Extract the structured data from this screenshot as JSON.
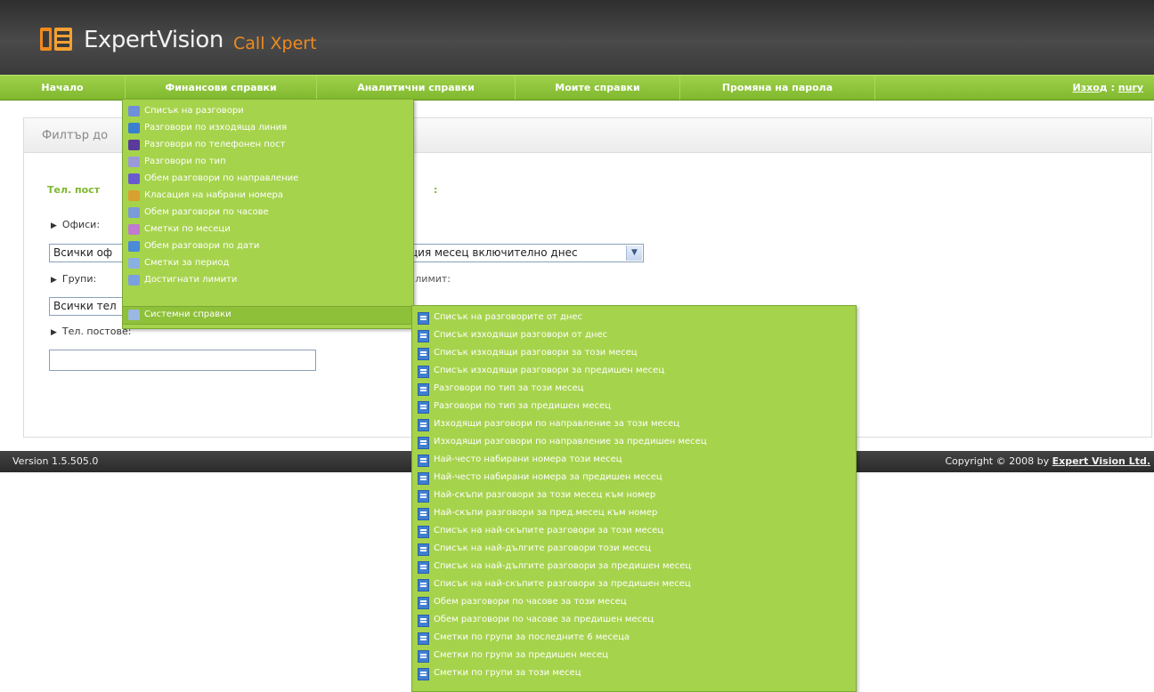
{
  "header": {
    "brand_name": "ExpertVision",
    "brand_product": "Call Xpert"
  },
  "nav": {
    "items": [
      "Начало",
      "Финансови справки",
      "Аналитични справки",
      "Моите справки",
      "Промяна на парола"
    ],
    "logout_label": "Изход",
    "username": "nury"
  },
  "filter": {
    "title": "Филтър до",
    "phone_line_title": "Тел. пост",
    "phone_line_suffix": ":",
    "offices_label": "Офиси:",
    "offices_value": "Всички оф",
    "period_value": "ция месец включително днес",
    "groups_label": "Групи:",
    "limit_label": "г лимит:",
    "groups_value": "Всички тел",
    "phone_posts_label": "Тел. постове:",
    "phone_posts_value": ""
  },
  "footer": {
    "version": "Version 1.5.505.0",
    "copyright_prefix": "Copyright © 2008 by ",
    "copyright_link": "Expert Vision Ltd."
  },
  "financial_menu": {
    "items": [
      {
        "label": "Списък на разговори",
        "icon": "list-icon",
        "color": "#6f8fd8"
      },
      {
        "label": "Разговори по изходяща линия",
        "icon": "bar-chart-icon",
        "color": "#3a7fd0"
      },
      {
        "label": "Разговори по телефонен пост",
        "icon": "area-chart-icon",
        "color": "#5a3a9a"
      },
      {
        "label": "Разговори по тип",
        "icon": "pie-chart-icon",
        "color": "#9a9ad8"
      },
      {
        "label": "Обем разговори по направление",
        "icon": "bar-chart-icon",
        "color": "#6a5ad0"
      },
      {
        "label": "Класация на набрани номера",
        "icon": "ranking-icon",
        "color": "#d8a030"
      },
      {
        "label": "Обем разговори по часове",
        "icon": "clock-chart-icon",
        "color": "#7a9ad8"
      },
      {
        "label": "Сметки по месеци",
        "icon": "line-chart-icon",
        "color": "#c07ad0"
      },
      {
        "label": "Обем разговори по дати",
        "icon": "calendar-chart-icon",
        "color": "#4a8ad8"
      },
      {
        "label": "Сметки за период",
        "icon": "period-icon",
        "color": "#8ab0e0"
      },
      {
        "label": "Достигнати лимити",
        "icon": "limit-icon",
        "color": "#7aa0e0"
      },
      {
        "label": "Системни справки",
        "icon": "system-icon",
        "color": "#9ab8e0"
      }
    ]
  },
  "system_menu": {
    "items": [
      "Списък на разговорите от днес",
      "Списък изходящи разговори от днес",
      "Списък изходящи разговори за този месец",
      "Списък изходящи разговори за предишен месец",
      "Разговори по тип за този месец",
      "Разговори по тип за предишен месец",
      "Изходящи разговори по направление за този месец",
      "Изходящи разговори по направление за предишен месец",
      "Най-често набирани номера този месец",
      "Най-често набирани номера за предишен месец",
      "Най-скъпи разговори за този месец към номер",
      "Най-скъпи разговори за пред.месец към номер",
      "Списък на най-скъпите разговори за този месец",
      "Списък на най-дългите разговори този месец",
      "Списък на най-дългите разговори за предишен месец",
      "Списък на най-скъпите разговори за предишен месец",
      "Обем разговори по часове за този месец",
      "Обем разговори по часове за предишен месец",
      "Сметки по групи за последните 6 месеца",
      "Сметки по групи за предишен месец",
      "Сметки по групи за този месец"
    ]
  }
}
